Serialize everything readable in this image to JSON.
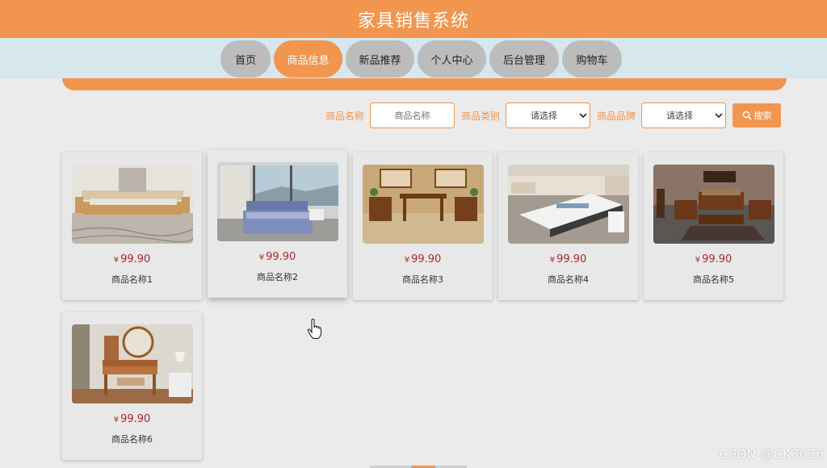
{
  "header": {
    "title": "家具销售系统"
  },
  "nav": {
    "items": [
      {
        "label": "首页"
      },
      {
        "label": "商品信息"
      },
      {
        "label": "新品推荐"
      },
      {
        "label": "个人中心"
      },
      {
        "label": "后台管理"
      },
      {
        "label": "购物车"
      }
    ],
    "active_index": 1
  },
  "search": {
    "name_label": "商品名称",
    "name_placeholder": "商品名称",
    "category_label": "商品类别",
    "category_selected": "请选择",
    "brand_label": "商品品牌",
    "brand_selected": "请选择",
    "button_label": "搜索",
    "button_icon": "search-icon"
  },
  "products": [
    {
      "currency": "¥",
      "price": "99.90",
      "name": "商品名称1",
      "image": "bedroom-bed"
    },
    {
      "currency": "¥",
      "price": "99.90",
      "name": "商品名称2",
      "image": "bed-lake-view"
    },
    {
      "currency": "¥",
      "price": "99.90",
      "name": "商品名称3",
      "image": "chinese-wood-table"
    },
    {
      "currency": "¥",
      "price": "99.90",
      "name": "商品名称4",
      "image": "living-room-coffee-table"
    },
    {
      "currency": "¥",
      "price": "99.90",
      "name": "商品名称5",
      "image": "wooden-sofa-set"
    },
    {
      "currency": "¥",
      "price": "99.90",
      "name": "商品名称6",
      "image": "vanity-dresser"
    }
  ],
  "watermark": "CSDN @CK3036",
  "colors": {
    "accent": "#f2954f",
    "nav_band": "#d6e7ee",
    "price": "#b0252c",
    "background": "#ebebeb"
  }
}
